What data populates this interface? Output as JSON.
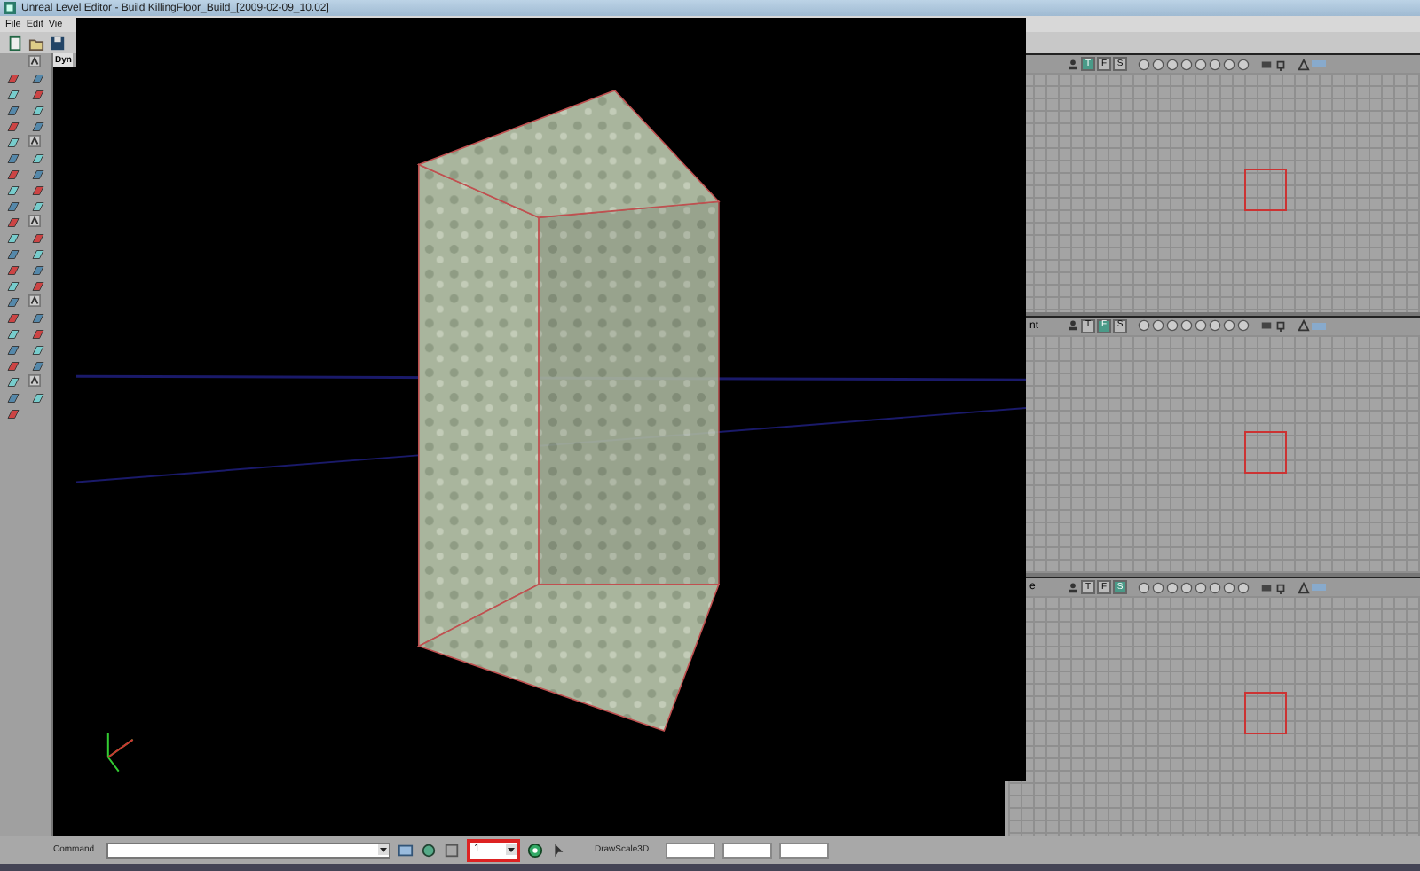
{
  "window": {
    "title": "Unreal Level Editor - Build KillingFloor_Build_[2009-02-09_10.02]"
  },
  "menu": [
    "File",
    "Edit",
    "Vie"
  ],
  "left_viewport_tab": "Dyn",
  "ortho_viewports": [
    {
      "modes": [
        {
          "label": "T",
          "selected": true
        },
        {
          "label": "F",
          "selected": false
        },
        {
          "label": "S",
          "selected": false
        }
      ]
    },
    {
      "label": "nt",
      "modes": [
        {
          "label": "T",
          "selected": false
        },
        {
          "label": "F",
          "selected": true
        },
        {
          "label": "S",
          "selected": false
        }
      ]
    },
    {
      "label": "e",
      "modes": [
        {
          "label": "T",
          "selected": false
        },
        {
          "label": "F",
          "selected": false
        },
        {
          "label": "S",
          "selected": true
        }
      ]
    }
  ],
  "bottom_bar": {
    "command_label": "Command",
    "grid_value": "1",
    "grid_highlighted": true,
    "drawscale_label": "DrawScale3D"
  }
}
